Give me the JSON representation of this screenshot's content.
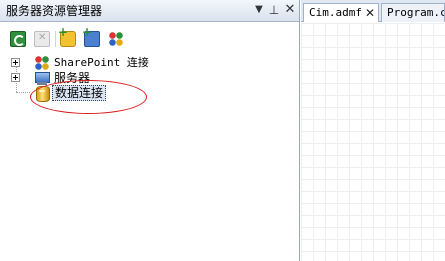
{
  "panel": {
    "title": "服务器资源管理器",
    "header_buttons": {
      "dropdown": "▼",
      "pin": "⊥",
      "close": "✕"
    },
    "toolbar": [
      "refresh-icon",
      "stop-icon",
      "add-connection-icon",
      "add-server-icon",
      "sharepoint-icon"
    ]
  },
  "tree": {
    "items": [
      {
        "label": "SharePoint 连接",
        "icon": "sharepoint-icon",
        "expandable": true
      },
      {
        "label": "服务器",
        "icon": "server-icon",
        "expandable": true
      },
      {
        "label": "数据连接",
        "icon": "database-icon",
        "expandable": false,
        "selected": true
      }
    ]
  },
  "annotation": {
    "color": "#d81e1e",
    "target": "数据连接"
  },
  "document": {
    "tabs": [
      {
        "label": "Cim.admf",
        "active": true,
        "close": "✕"
      },
      {
        "label": "Program.cs",
        "active": false
      }
    ]
  }
}
